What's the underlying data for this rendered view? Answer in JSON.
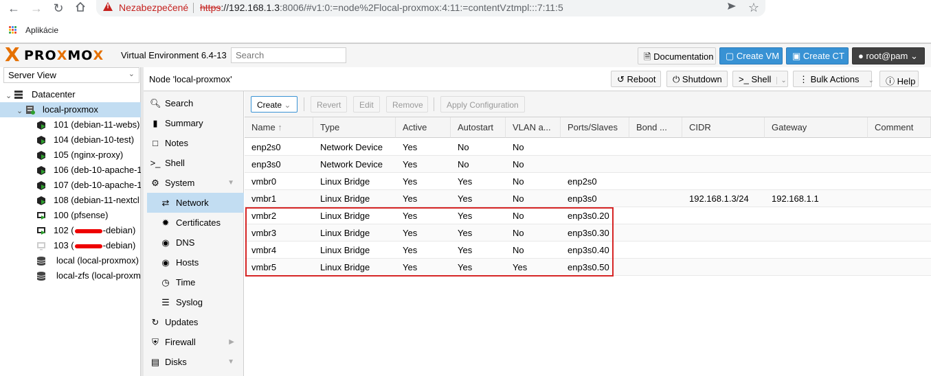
{
  "browser": {
    "insecure_label": "Nezabezpečené",
    "url_scheme": "https",
    "url_host": "://192.168.1.3",
    "url_rest": ":8006/#v1:0:=node%2Flocal-proxmox:4:11:=contentVztmpl:::7:11:5",
    "bookmark_label": "Aplikácie"
  },
  "header": {
    "logo_x": "X",
    "logo_pro": "PRO",
    "logo_x2": "X",
    "logo_mo": "MO",
    "logo_x3": "X",
    "version": "Virtual Environment 6.4-13",
    "search_placeholder": "Search",
    "documentation": "Documentation",
    "create_vm": "Create VM",
    "create_ct": "Create CT",
    "user": "root@pam"
  },
  "tree": {
    "view": "Server View",
    "items": [
      {
        "label": "Datacenter"
      },
      {
        "label": "local-proxmox"
      },
      {
        "label": "101 (debian-11-webs)"
      },
      {
        "label": "104 (debian-10-test)"
      },
      {
        "label": "105 (nginx-proxy)"
      },
      {
        "label": "106 (deb-10-apache-1"
      },
      {
        "label": "107 (deb-10-apache-1"
      },
      {
        "label": "108 (debian-11-nextcl"
      },
      {
        "label": "100 (pfsense)"
      },
      {
        "label_pre": "102 (",
        "label_post": "-debian)"
      },
      {
        "label_pre": "103 (",
        "label_post": "-debian)"
      },
      {
        "label": "local (local-proxmox)"
      },
      {
        "label": "local-zfs (local-proxm"
      }
    ]
  },
  "content": {
    "title": "Node 'local-proxmox'",
    "reboot": "Reboot",
    "shutdown": "Shutdown",
    "shell": "Shell",
    "bulk": "Bulk Actions",
    "help": "Help"
  },
  "menu": {
    "items": [
      {
        "label": "Search"
      },
      {
        "label": "Summary"
      },
      {
        "label": "Notes"
      },
      {
        "label": "Shell"
      },
      {
        "label": "System"
      },
      {
        "label": "Network"
      },
      {
        "label": "Certificates"
      },
      {
        "label": "DNS"
      },
      {
        "label": "Hosts"
      },
      {
        "label": "Time"
      },
      {
        "label": "Syslog"
      },
      {
        "label": "Updates"
      },
      {
        "label": "Firewall"
      },
      {
        "label": "Disks"
      }
    ]
  },
  "toolbar": {
    "create": "Create",
    "revert": "Revert",
    "edit": "Edit",
    "remove": "Remove",
    "apply": "Apply Configuration"
  },
  "grid": {
    "columns": [
      "Name",
      "Type",
      "Active",
      "Autostart",
      "VLAN a...",
      "Ports/Slaves",
      "Bond ...",
      "CIDR",
      "Gateway",
      "Comment"
    ],
    "rows": [
      [
        "enp2s0",
        "Network Device",
        "Yes",
        "No",
        "No",
        "",
        "",
        "",
        "",
        ""
      ],
      [
        "enp3s0",
        "Network Device",
        "Yes",
        "No",
        "No",
        "",
        "",
        "",
        "",
        ""
      ],
      [
        "vmbr0",
        "Linux Bridge",
        "Yes",
        "Yes",
        "No",
        "enp2s0",
        "",
        "",
        "",
        ""
      ],
      [
        "vmbr1",
        "Linux Bridge",
        "Yes",
        "Yes",
        "No",
        "enp3s0",
        "",
        "192.168.1.3/24",
        "192.168.1.1",
        ""
      ],
      [
        "vmbr2",
        "Linux Bridge",
        "Yes",
        "Yes",
        "No",
        "enp3s0.20",
        "",
        "",
        "",
        ""
      ],
      [
        "vmbr3",
        "Linux Bridge",
        "Yes",
        "Yes",
        "No",
        "enp3s0.30",
        "",
        "",
        "",
        ""
      ],
      [
        "vmbr4",
        "Linux Bridge",
        "Yes",
        "Yes",
        "No",
        "enp3s0.40",
        "",
        "",
        "",
        ""
      ],
      [
        "vmbr5",
        "Linux Bridge",
        "Yes",
        "Yes",
        "Yes",
        "enp3s0.50",
        "",
        "",
        "",
        ""
      ]
    ]
  },
  "colors": {
    "accent": "#3892d4",
    "selection": "#c2ddf2",
    "brand": "#e57000",
    "highlight": "#d62424"
  }
}
